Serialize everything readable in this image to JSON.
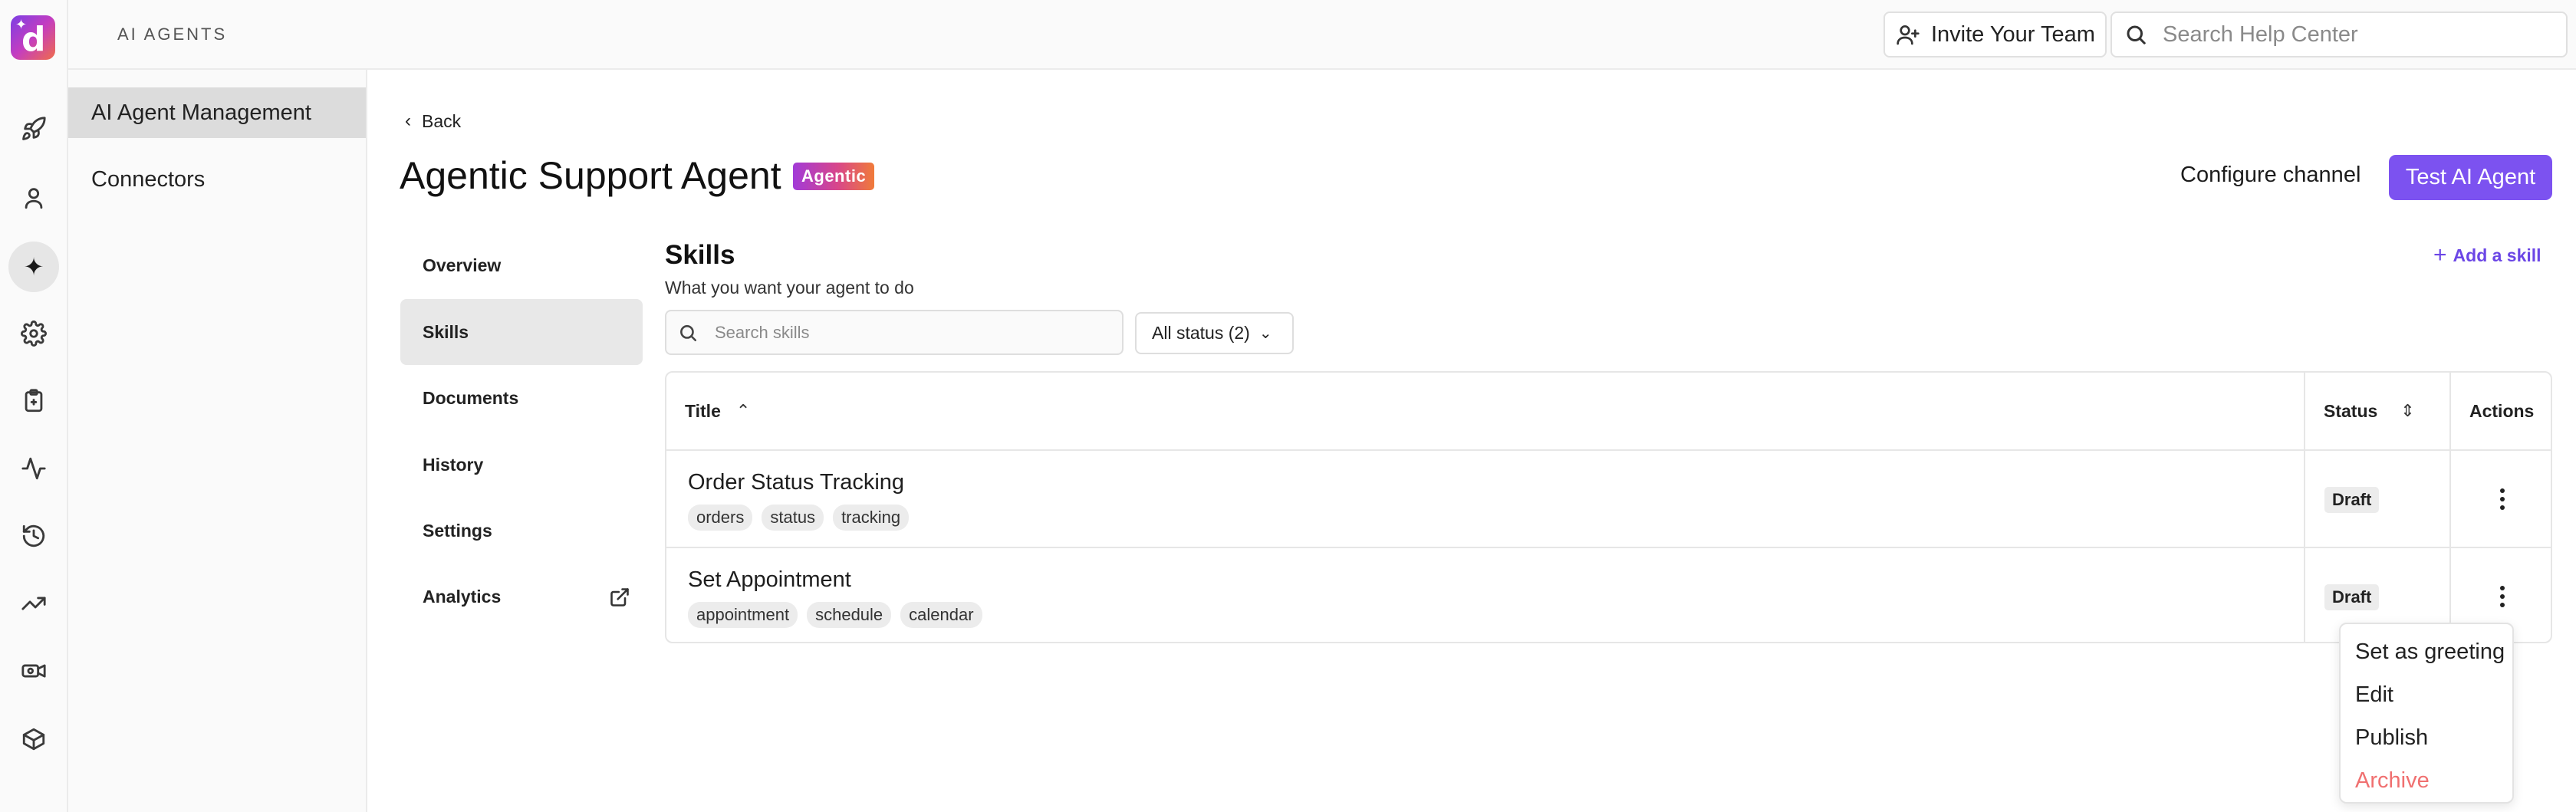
{
  "app": {
    "section_title": "AI AGENTS"
  },
  "topbar": {
    "invite_label": "Invite Your Team",
    "help_search_placeholder": "Search Help Center"
  },
  "sidebar": {
    "items": [
      {
        "label": "AI Agent Management",
        "active": true
      },
      {
        "label": "Connectors",
        "active": false
      }
    ]
  },
  "rail": {
    "icons": [
      "rocket-icon",
      "user-icon",
      "sparkle-icon",
      "gear-icon",
      "clipboard-icon",
      "activity-icon",
      "history-icon",
      "trending-icon",
      "camera-icon",
      "box-icon"
    ]
  },
  "header": {
    "back_label": "Back",
    "title": "Agentic Support Agent",
    "badge": "Agentic",
    "configure_label": "Configure channel",
    "test_label": "Test AI Agent"
  },
  "tabs": [
    {
      "label": "Overview",
      "active": false
    },
    {
      "label": "Skills",
      "active": true
    },
    {
      "label": "Documents",
      "active": false
    },
    {
      "label": "History",
      "active": false
    },
    {
      "label": "Settings",
      "active": false
    },
    {
      "label": "Analytics",
      "active": false
    }
  ],
  "skills": {
    "title": "Skills",
    "subtitle": "What you want your agent to do",
    "add_label": "Add a skill",
    "search_placeholder": "Search skills",
    "status_filter": "All status (2)",
    "columns": {
      "title": "Title",
      "status": "Status",
      "actions": "Actions"
    },
    "rows": [
      {
        "title": "Order Status Tracking",
        "tags": [
          "orders",
          "status",
          "tracking"
        ],
        "status": "Draft"
      },
      {
        "title": "Set Appointment",
        "tags": [
          "appointment",
          "schedule",
          "calendar"
        ],
        "status": "Draft"
      }
    ]
  },
  "menu": {
    "items": [
      "Set as greeting",
      "Edit",
      "Publish",
      "Archive"
    ]
  },
  "colors": {
    "accent": "#7c52f0",
    "link": "#6b46e6",
    "danger": "#f07070"
  }
}
